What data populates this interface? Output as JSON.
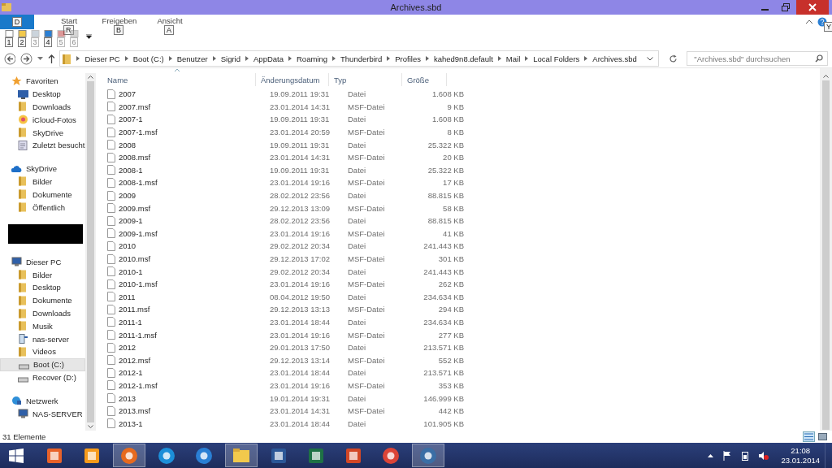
{
  "window": {
    "title": "Archives.sbd"
  },
  "ribbon": {
    "file_tab": {
      "keytip": "D"
    },
    "tabs": [
      {
        "label": "Start",
        "keytip": "R",
        "selected": false
      },
      {
        "label": "Freigeben",
        "keytip": "B",
        "selected": false
      },
      {
        "label": "Ansicht",
        "keytip": "A",
        "selected": false
      }
    ],
    "help_keytip": "Y",
    "quick_access": [
      {
        "kind": "properties",
        "keytip": "1",
        "disabled": false
      },
      {
        "kind": "new-folder",
        "keytip": "2",
        "disabled": false
      },
      {
        "kind": "undo",
        "keytip": "3",
        "disabled": true
      },
      {
        "kind": "redo",
        "keytip": "4",
        "disabled": false
      },
      {
        "kind": "delete",
        "keytip": "5",
        "disabled": true
      },
      {
        "kind": "rename",
        "keytip": "6",
        "disabled": true
      }
    ]
  },
  "address_bar": {
    "path": [
      "Dieser PC",
      "Boot (C:)",
      "Benutzer",
      "Sigrid",
      "AppData",
      "Roaming",
      "Thunderbird",
      "Profiles",
      "kahed9n8.default",
      "Mail",
      "Local Folders",
      "Archives.sbd"
    ],
    "search": {
      "placeholder": "\"Archives.sbd\" durchsuchen"
    }
  },
  "navigation": [
    {
      "kind": "favorites",
      "label": "Favoriten",
      "selected": false,
      "children": [
        {
          "kind": "desktop",
          "label": "Desktop",
          "selected": false
        },
        {
          "kind": "downloads",
          "label": "Downloads",
          "selected": false
        },
        {
          "kind": "photos",
          "label": "iCloud-Fotos",
          "selected": false
        },
        {
          "kind": "skydrive-folder",
          "label": "SkyDrive",
          "selected": false
        },
        {
          "kind": "recent",
          "label": "Zuletzt besucht",
          "selected": false
        }
      ]
    },
    {
      "kind": "cloud",
      "label": "SkyDrive",
      "selected": false,
      "children": [
        {
          "kind": "folder",
          "label": "Bilder",
          "selected": false
        },
        {
          "kind": "folder",
          "label": "Dokumente",
          "selected": false
        },
        {
          "kind": "folder",
          "label": "Öffentlich",
          "selected": false
        }
      ]
    },
    {
      "kind": "redacted"
    },
    {
      "kind": "pc",
      "label": "Dieser PC",
      "selected": false,
      "children": [
        {
          "kind": "pictures",
          "label": "Bilder",
          "selected": false
        },
        {
          "kind": "desktop-folder",
          "label": "Desktop",
          "selected": false
        },
        {
          "kind": "documents",
          "label": "Dokumente",
          "selected": false
        },
        {
          "kind": "downloads",
          "label": "Downloads",
          "selected": false
        },
        {
          "kind": "music",
          "label": "Musik",
          "selected": false
        },
        {
          "kind": "network-drive",
          "label": "nas-server",
          "selected": false
        },
        {
          "kind": "videos",
          "label": "Videos",
          "selected": false
        },
        {
          "kind": "drive",
          "label": "Boot (C:)",
          "selected": true
        },
        {
          "kind": "removable",
          "label": "Recover (D:)",
          "selected": false
        }
      ]
    },
    {
      "kind": "network",
      "label": "Netzwerk",
      "selected": false,
      "children": [
        {
          "kind": "computer",
          "label": "NAS-SERVER",
          "selected": false
        }
      ]
    }
  ],
  "file_list": {
    "columns": [
      "Name",
      "Änderungsdatum",
      "Typ",
      "Größe"
    ],
    "rows": [
      [
        "2007",
        "19.09.2011 19:31",
        "Datei",
        "1.608 KB"
      ],
      [
        "2007.msf",
        "23.01.2014 14:31",
        "MSF-Datei",
        "9 KB"
      ],
      [
        "2007-1",
        "19.09.2011 19:31",
        "Datei",
        "1.608 KB"
      ],
      [
        "2007-1.msf",
        "23.01.2014 20:59",
        "MSF-Datei",
        "8 KB"
      ],
      [
        "2008",
        "19.09.2011 19:31",
        "Datei",
        "25.322 KB"
      ],
      [
        "2008.msf",
        "23.01.2014 14:31",
        "MSF-Datei",
        "20 KB"
      ],
      [
        "2008-1",
        "19.09.2011 19:31",
        "Datei",
        "25.322 KB"
      ],
      [
        "2008-1.msf",
        "23.01.2014 19:16",
        "MSF-Datei",
        "17 KB"
      ],
      [
        "2009",
        "28.02.2012 23:56",
        "Datei",
        "88.815 KB"
      ],
      [
        "2009.msf",
        "29.12.2013 13:09",
        "MSF-Datei",
        "58 KB"
      ],
      [
        "2009-1",
        "28.02.2012 23:56",
        "Datei",
        "88.815 KB"
      ],
      [
        "2009-1.msf",
        "23.01.2014 19:16",
        "MSF-Datei",
        "41 KB"
      ],
      [
        "2010",
        "29.02.2012 20:34",
        "Datei",
        "241.443 KB"
      ],
      [
        "2010.msf",
        "29.12.2013 17:02",
        "MSF-Datei",
        "301 KB"
      ],
      [
        "2010-1",
        "29.02.2012 20:34",
        "Datei",
        "241.443 KB"
      ],
      [
        "2010-1.msf",
        "23.01.2014 19:16",
        "MSF-Datei",
        "262 KB"
      ],
      [
        "2011",
        "08.04.2012 19:50",
        "Datei",
        "234.634 KB"
      ],
      [
        "2011.msf",
        "29.12.2013 13:13",
        "MSF-Datei",
        "294 KB"
      ],
      [
        "2011-1",
        "23.01.2014 18:44",
        "Datei",
        "234.634 KB"
      ],
      [
        "2011-1.msf",
        "23.01.2014 19:16",
        "MSF-Datei",
        "277 KB"
      ],
      [
        "2012",
        "29.01.2013 17:50",
        "Datei",
        "213.571 KB"
      ],
      [
        "2012.msf",
        "29.12.2013 13:14",
        "MSF-Datei",
        "552 KB"
      ],
      [
        "2012-1",
        "23.01.2014 18:44",
        "Datei",
        "213.571 KB"
      ],
      [
        "2012-1.msf",
        "23.01.2014 19:16",
        "MSF-Datei",
        "353 KB"
      ],
      [
        "2013",
        "19.01.2014 19:31",
        "Datei",
        "146.999 KB"
      ],
      [
        "2013.msf",
        "23.01.2014 14:31",
        "MSF-Datei",
        "442 KB"
      ],
      [
        "2013-1",
        "23.01.2014 18:44",
        "Datei",
        "101.905 KB"
      ]
    ]
  },
  "status_bar": {
    "item_count": "31 Elemente",
    "views": [
      {
        "kind": "details",
        "selected": true
      },
      {
        "kind": "tiles",
        "selected": false
      }
    ]
  },
  "taskbar": {
    "apps": [
      {
        "kind": "office",
        "active": false
      },
      {
        "kind": "media",
        "active": false
      },
      {
        "kind": "firefox",
        "active": true
      },
      {
        "kind": "ie",
        "active": false
      },
      {
        "kind": "itunes",
        "active": false
      },
      {
        "kind": "explorer",
        "active": true
      },
      {
        "kind": "word",
        "active": false
      },
      {
        "kind": "excel",
        "active": false
      },
      {
        "kind": "powerpoint",
        "active": false
      },
      {
        "kind": "chrome",
        "active": false
      },
      {
        "kind": "thunderbird",
        "active": true
      }
    ],
    "clock": {
      "time": "21:08",
      "date": "23.01.2014"
    }
  }
}
